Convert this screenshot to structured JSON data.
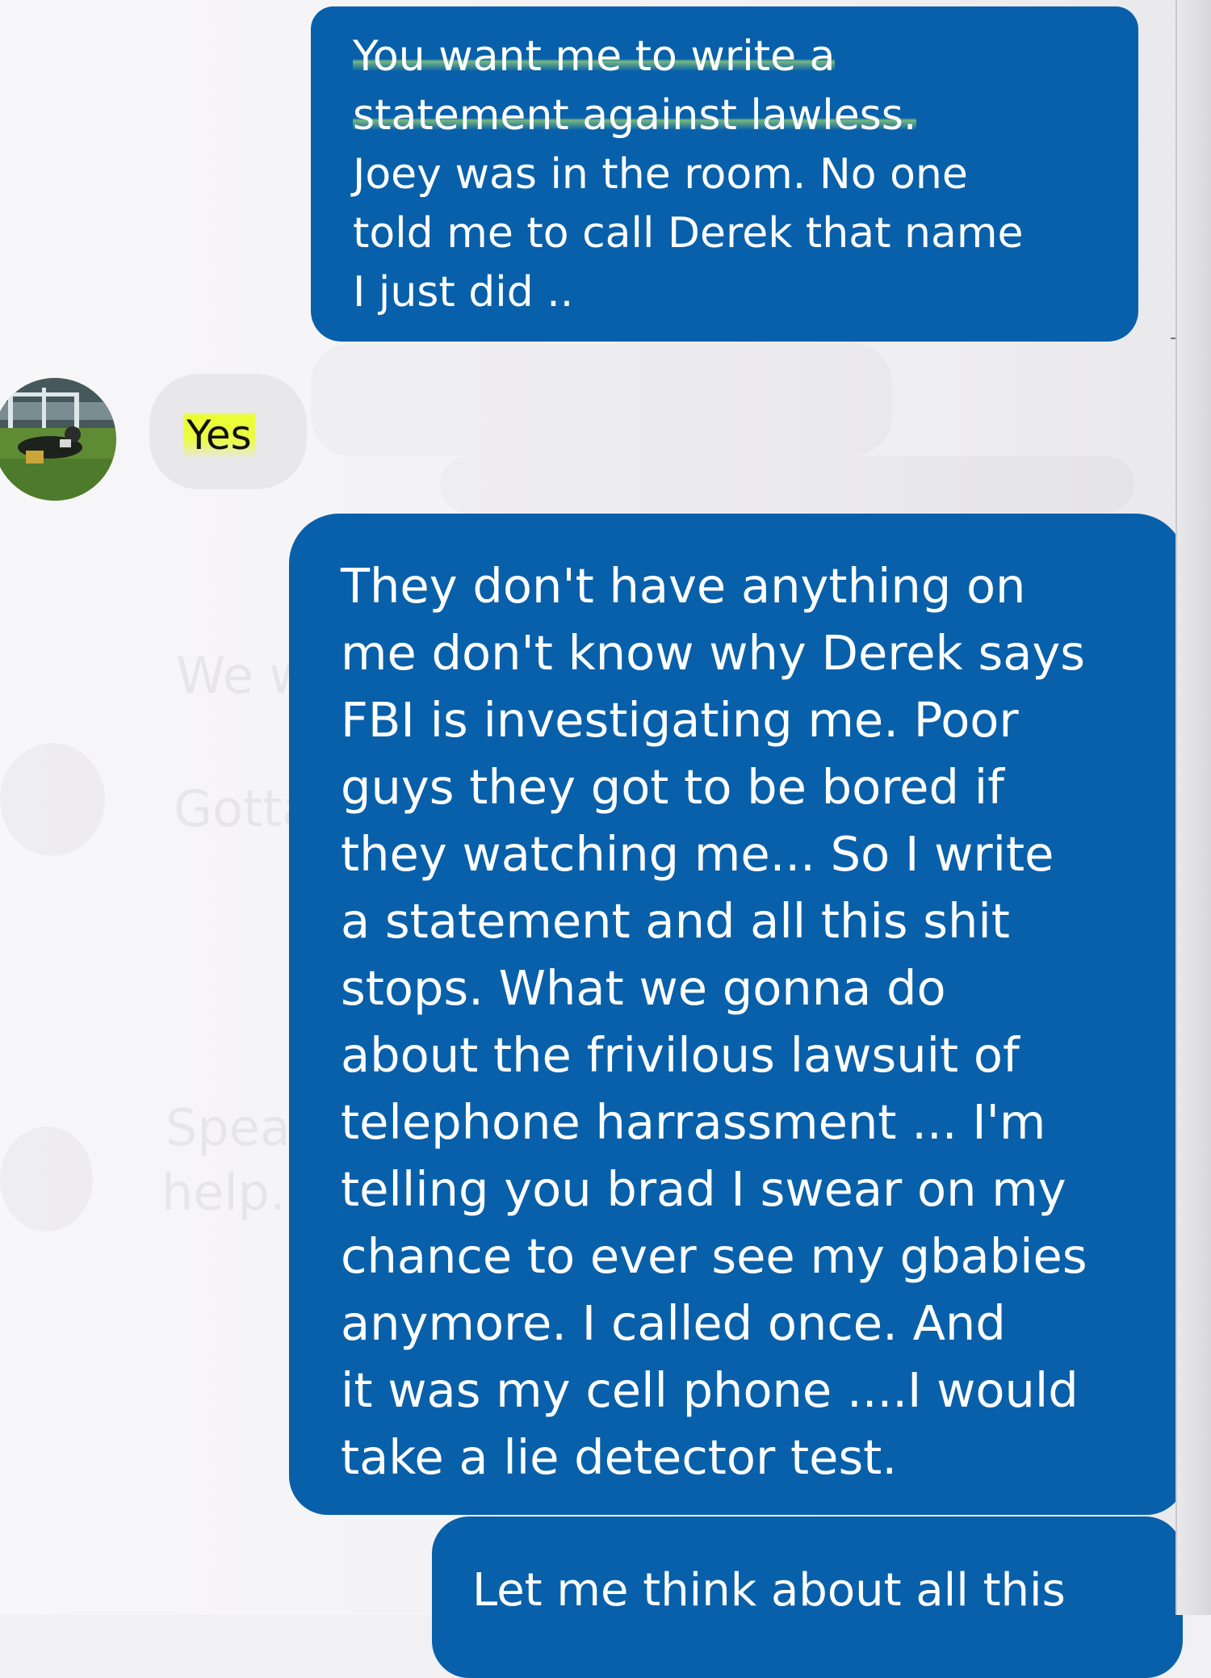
{
  "conversation": {
    "messages": [
      {
        "direction": "outgoing",
        "text_lines": [
          "You want me to write a",
          "statement against lawless.",
          "Joey was in the room.  No one",
          "told me to call Derek that name",
          "I just did .."
        ]
      },
      {
        "direction": "incoming",
        "text": "Yes"
      },
      {
        "direction": "outgoing",
        "text_lines": [
          "They don't have anything on",
          "me don't know why Derek says",
          "FBI is investigating me.  Poor",
          "guys they got to be bored if",
          "they watching me... So I write",
          "a statement and all this shit",
          "stops.  What we gonna do",
          "about the frivilous lawsuit of",
          "telephone harrassment ...  I'm",
          "telling you brad I swear on my",
          "chance to ever see my gbabies",
          "anymore.  I called once.  And",
          "it was my cell phone ....I would",
          "take a lie detector test."
        ]
      },
      {
        "direction": "outgoing",
        "text": "Let me think about all this"
      }
    ]
  },
  "colors": {
    "outgoing_bubble": "#0860aa",
    "incoming_bubble": "#e8e7ea",
    "highlight": "#eaff28"
  }
}
